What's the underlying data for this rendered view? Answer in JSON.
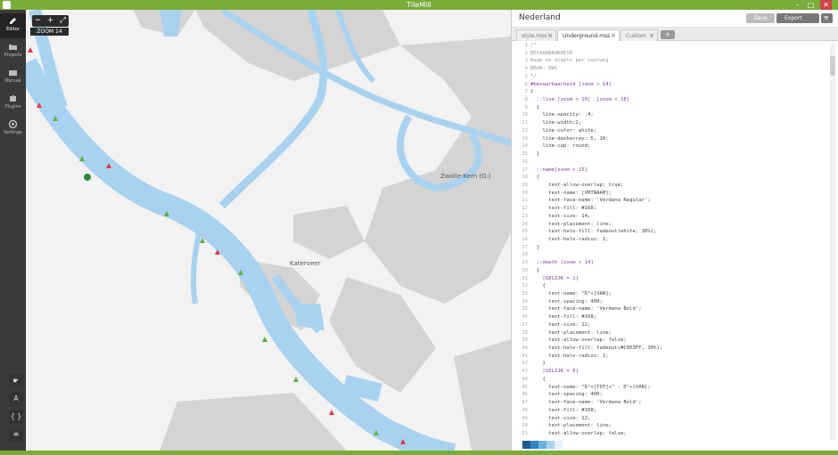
{
  "window": {
    "title": "TileMill"
  },
  "sidebar": {
    "items": [
      {
        "label": "Editor",
        "icon": "pencil-icon",
        "active": true
      },
      {
        "label": "Projects",
        "icon": "folder-icon",
        "active": false
      },
      {
        "label": "Manual",
        "icon": "keyboard-icon",
        "active": false
      },
      {
        "label": "Plugins",
        "icon": "puzzle-icon",
        "active": false
      },
      {
        "label": "Settings",
        "icon": "gear-icon",
        "active": false
      }
    ],
    "tools": [
      {
        "icon": "pointer-icon",
        "glyph": "☛"
      },
      {
        "icon": "font-icon",
        "glyph": "A"
      },
      {
        "icon": "braces-icon",
        "glyph": "{ }"
      },
      {
        "icon": "layers-icon",
        "glyph": "≡"
      }
    ]
  },
  "map": {
    "zoom_out": "−",
    "zoom_in": "+",
    "fullscreen": "⤢",
    "zoom_label": "ZOOM 14",
    "labels": [
      "Zwolle-Kern (O.)",
      "Katerveer"
    ],
    "colors": {
      "land": "#f2f2f2",
      "urban": "#d4d4d4",
      "water": "#a9d2f0"
    }
  },
  "editor": {
    "project_title": "Nederland",
    "save_label": "Save",
    "export_label": "Export",
    "tabs": [
      {
        "label": "style.mss",
        "active": false
      },
      {
        "label": "Underground.mss",
        "active": true
      },
      {
        "label": "Custom",
        "active": false
      }
    ],
    "add_tab": "+",
    "code_lines": [
      "/*",
      "BEVAARBAARHEID",
      "Naam en diepte per vaarweg",
      "BRON: RWS",
      "*/",
      "#bevaarbaarheid [zoom > 14]",
      "{",
      "  ::line [zoom > 10]  [zoom < 18]",
      "  {",
      "    line-opacity: .4;",
      "    line-width:2;",
      "    line-color: white;",
      "    line-dasharray: 5, 10;",
      "    line-cap: round;",
      "  }",
      "",
      "  ::name[zoom > 15]",
      "  {",
      "      text-allow-overlap: true;",
      "      text-name: [VRTNAAM];",
      "      text-face-name: 'Verdana Regular';",
      "      text-fill: #168;",
      "      text-size: 14;",
      "      text-placement: line;",
      "      text-halo-fill: fadeout(white, 30%);",
      "      text-halo-radius: 1;",
      "  }",
      "",
      "  ::depth [zoom > 14]",
      "  {",
      "    [GELIJK = 1]",
      "    {",
      "      text-name: \"D\"+[VAN];",
      "      text-spacing: 400;",
      "      text-face-name: 'Verdana Bold';",
      "      text-fill: #168;",
      "      text-size: 12;",
      "      text-placement: line;",
      "      text-allow-overlap: false;",
      "      text-halo-fill: fadeout(#C0E3FF, 30%);",
      "      text-halo-radius: 1;",
      "    }",
      "    [GELIJK = 0]",
      "    {",
      "      text-name: \"D\"+[TOT]+\" - D\"+[VAN];",
      "      text-spacing: 400;",
      "      text-face-name: 'Verdana Bold';",
      "      text-fill: #168;",
      "      text-size: 12;",
      "      text-placement: line;",
      "      text-allow-overlap: false;"
    ],
    "palette": [
      "#1d5a8a",
      "#2f86c4",
      "#6bb1e0",
      "#a9d2f0",
      "#e8f1f8"
    ]
  },
  "colors": {
    "accent": "#78ad39",
    "sidebar": "#3a3a3a"
  }
}
